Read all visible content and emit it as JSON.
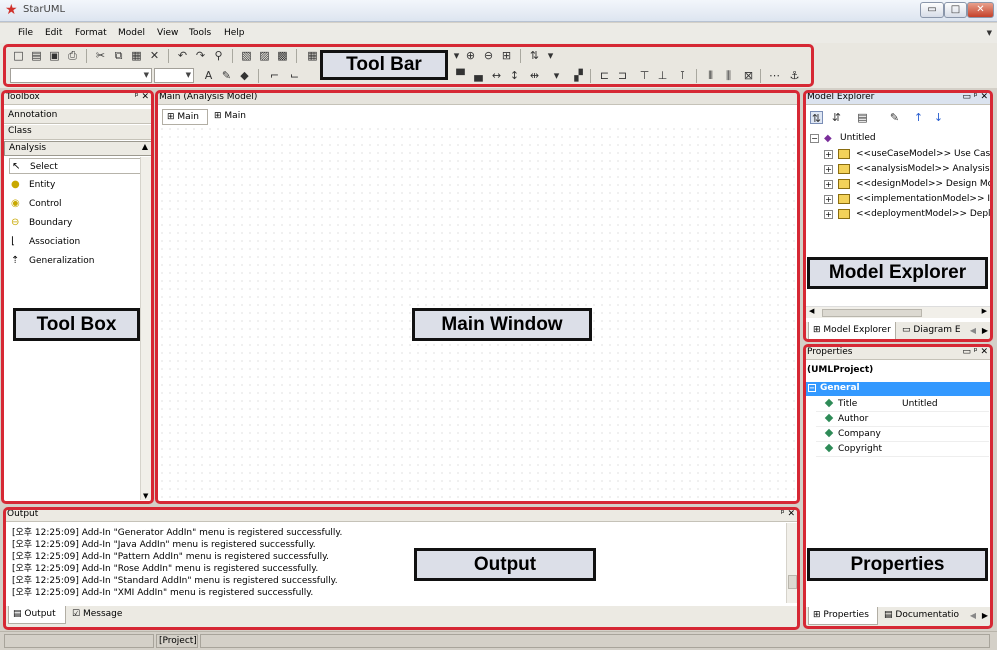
{
  "window": {
    "title": "StarUML",
    "controls": {
      "minimize": "▭",
      "maximize": "□",
      "close": "✕"
    }
  },
  "menu": [
    "File",
    "Edit",
    "Format",
    "Model",
    "View",
    "Tools",
    "Help"
  ],
  "annotations": {
    "toolbar": "Tool Bar",
    "toolbox": "Tool Box",
    "main": "Main Window",
    "explorer": "Model Explorer",
    "output": "Output",
    "properties": "Properties"
  },
  "toolbox": {
    "title": "Toolbox",
    "categories": [
      "Annotation",
      "Class",
      "Analysis"
    ],
    "items": [
      {
        "label": "Select",
        "icon": "arrow-pointer-icon"
      },
      {
        "label": "Entity",
        "icon": "entity-icon"
      },
      {
        "label": "Control",
        "icon": "control-icon"
      },
      {
        "label": "Boundary",
        "icon": "boundary-icon"
      },
      {
        "label": "Association",
        "icon": "association-icon"
      },
      {
        "label": "Generalization",
        "icon": "generalization-icon"
      }
    ]
  },
  "main": {
    "title": "Main (Analysis Model)",
    "tabs": [
      "Main",
      "Main"
    ]
  },
  "explorer": {
    "title": "Model Explorer",
    "root": "Untitled",
    "nodes": [
      "<<useCaseModel>> Use Case M",
      "<<analysisModel>> Analysis Mo",
      "<<designModel>> Design Mode",
      "<<implementationModel>> Imp",
      "<<deploymentModel>> Deploym"
    ],
    "tabs": [
      "Model Explorer",
      "Diagram E"
    ]
  },
  "properties": {
    "title": "Properties",
    "subject": "(UMLProject)",
    "group": "General",
    "rows": [
      {
        "name": "Title",
        "value": "Untitled"
      },
      {
        "name": "Author",
        "value": ""
      },
      {
        "name": "Company",
        "value": ""
      },
      {
        "name": "Copyright",
        "value": ""
      }
    ],
    "tabs": [
      "Properties",
      "Documentatio"
    ]
  },
  "output": {
    "title": "Output",
    "lines": [
      "[오후 12:25:09]  Add-In \"Generator AddIn\" menu is registered successfully.",
      "[오후 12:25:09]  Add-In \"Java AddIn\" menu is registered successfully.",
      "[오후 12:25:09]  Add-In \"Pattern AddIn\" menu is registered successfully.",
      "[오후 12:25:09]  Add-In \"Rose AddIn\" menu is registered successfully.",
      "[오후 12:25:09]  Add-In \"Standard AddIn\" menu is registered successfully.",
      "[오후 12:25:09]  Add-In \"XMI AddIn\" menu is registered successfully."
    ],
    "tabs": [
      "Output",
      "Message"
    ]
  },
  "statusbar": {
    "text": "[Project]"
  },
  "colors": {
    "highlight": "#d62834",
    "selection": "#3399ff"
  }
}
